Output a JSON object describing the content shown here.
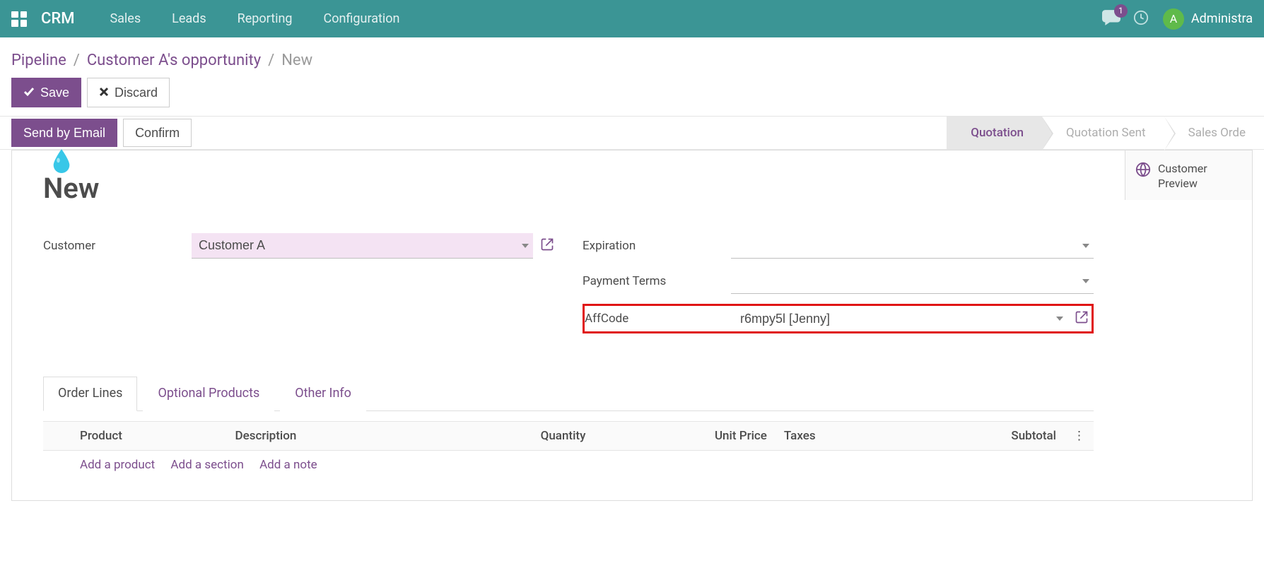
{
  "topnav": {
    "brand": "CRM",
    "items": [
      "Sales",
      "Leads",
      "Reporting",
      "Configuration"
    ],
    "chat_badge": "1",
    "avatar_letter": "A",
    "username": "Administra"
  },
  "breadcrumbs": {
    "items": [
      "Pipeline",
      "Customer A's opportunity"
    ],
    "current": "New"
  },
  "buttons": {
    "save": "Save",
    "discard": "Discard",
    "send_email": "Send by Email",
    "confirm": "Confirm"
  },
  "statusbar": {
    "stages": [
      "Quotation",
      "Quotation Sent",
      "Sales Orde"
    ],
    "active_index": 0
  },
  "sidebar": {
    "customer_preview": "Customer Preview"
  },
  "form": {
    "title": "New",
    "left": {
      "customer_label": "Customer",
      "customer_value": "Customer A"
    },
    "right": {
      "expiration_label": "Expiration",
      "expiration_value": "",
      "payment_terms_label": "Payment Terms",
      "payment_terms_value": "",
      "affcode_label": "AffCode",
      "affcode_value": "r6mpy5l [Jenny]"
    }
  },
  "tabs": [
    "Order Lines",
    "Optional Products",
    "Other Info"
  ],
  "table": {
    "headers": {
      "product": "Product",
      "description": "Description",
      "quantity": "Quantity",
      "unit_price": "Unit Price",
      "taxes": "Taxes",
      "subtotal": "Subtotal"
    },
    "add_links": [
      "Add a product",
      "Add a section",
      "Add a note"
    ]
  }
}
